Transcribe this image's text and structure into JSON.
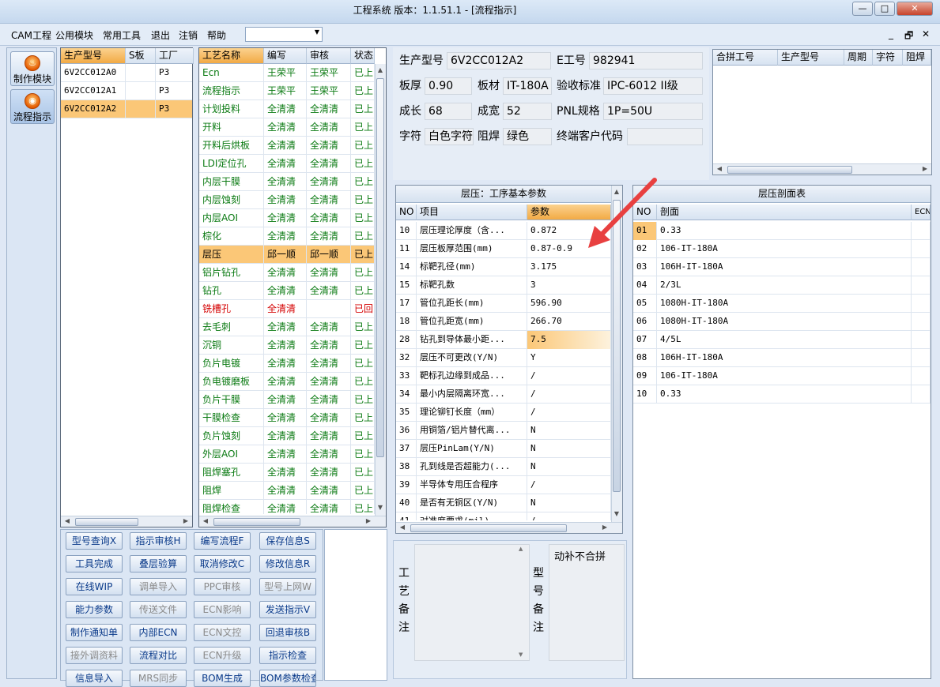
{
  "window": {
    "title": "工程系统  版本：1.1.51.1 - [流程指示]",
    "minimize": "—",
    "maximize": "□",
    "close": "✕"
  },
  "menu": [
    "CAM工程",
    "公用模块",
    "常用工具",
    "退出",
    "注销",
    "帮助"
  ],
  "mdi_controls": [
    "_",
    "🗗",
    "✕"
  ],
  "nav": [
    {
      "label": "制作模块",
      "icon": "fire-icon"
    },
    {
      "label": "流程指示",
      "icon": "gauge-icon"
    }
  ],
  "models_grid": {
    "headers": [
      "生产型号",
      "S板",
      "工厂"
    ],
    "rows": [
      [
        "6V2CC012A0",
        "",
        "P3"
      ],
      [
        "6V2CC012A1",
        "",
        "P3"
      ],
      [
        "6V2CC012A2",
        "",
        "P3"
      ]
    ],
    "selected": 2
  },
  "process_grid": {
    "headers": [
      "工艺名称",
      "编写",
      "审核",
      "状态"
    ],
    "rows": [
      [
        "Ecn",
        "王荣平",
        "王荣平",
        "已上"
      ],
      [
        "流程指示",
        "王荣平",
        "王荣平",
        "已上"
      ],
      [
        "计划投料",
        "全清清",
        "全清清",
        "已上"
      ],
      [
        "开料",
        "全清清",
        "全清清",
        "已上"
      ],
      [
        "开料后烘板",
        "全清清",
        "全清清",
        "已上"
      ],
      [
        "LDI定位孔",
        "全清清",
        "全清清",
        "已上"
      ],
      [
        "内层干膜",
        "全清清",
        "全清清",
        "已上"
      ],
      [
        "内层蚀刻",
        "全清清",
        "全清清",
        "已上"
      ],
      [
        "内层AOI",
        "全清清",
        "全清清",
        "已上"
      ],
      [
        "棕化",
        "全清清",
        "全清清",
        "已上"
      ],
      [
        "层压",
        "邱一顺",
        "邱一顺",
        "已上"
      ],
      [
        "铝片钻孔",
        "全清清",
        "全清清",
        "已上"
      ],
      [
        "钻孔",
        "全清清",
        "全清清",
        "已上"
      ],
      [
        "铣槽孔",
        "全清清",
        "",
        "已回"
      ],
      [
        "去毛刺",
        "全清清",
        "全清清",
        "已上"
      ],
      [
        "沉铜",
        "全清清",
        "全清清",
        "已上"
      ],
      [
        "负片电镀",
        "全清清",
        "全清清",
        "已上"
      ],
      [
        "负电镀磨板",
        "全清清",
        "全清清",
        "已上"
      ],
      [
        "负片干膜",
        "全清清",
        "全清清",
        "已上"
      ],
      [
        "干膜检查",
        "全清清",
        "全清清",
        "已上"
      ],
      [
        "负片蚀刻",
        "全清清",
        "全清清",
        "已上"
      ],
      [
        "外层AOI",
        "全清清",
        "全清清",
        "已上"
      ],
      [
        "阻焊塞孔",
        "全清清",
        "全清清",
        "已上"
      ],
      [
        "阻焊",
        "全清清",
        "全清清",
        "已上"
      ],
      [
        "阻焊检查",
        "全清清",
        "全清清",
        "已上"
      ]
    ],
    "selected": 10,
    "returned": 13
  },
  "info": {
    "prod_model_label": "生产型号",
    "prod_model": "6V2CC012A2",
    "eno_label": "E工号",
    "eno": "982941",
    "thickness_label": "板厚",
    "thickness": "0.90",
    "material_label": "板材",
    "material": "IT-180A",
    "standard_label": "验收标准",
    "standard": "IPC-6012 II级",
    "length_label": "成长",
    "length": "68",
    "width_label": "成宽",
    "width": "52",
    "pnl_label": "PNL规格",
    "pnl": "1P=50U",
    "char_label": "字符",
    "char": "白色字符",
    "mask_label": "阻焊",
    "mask": "绿色",
    "customer_label": "终端客户代码",
    "customer": ""
  },
  "merge_grid": {
    "headers": [
      "合拼工号",
      "生产型号",
      "周期",
      "字符",
      "阻焊"
    ]
  },
  "params": {
    "title": "层压：工序基本参数",
    "headers": [
      "NO",
      "项目",
      "参数"
    ],
    "rows": [
      [
        "10",
        "层压理论厚度（含...",
        "0.872"
      ],
      [
        "11",
        "层压板厚范围(mm)",
        "0.87-0.9"
      ],
      [
        "14",
        "标靶孔径(mm)",
        "3.175"
      ],
      [
        "15",
        "标靶孔数",
        "3"
      ],
      [
        "17",
        "管位孔距长(mm)",
        "596.90"
      ],
      [
        "18",
        "管位孔距宽(mm)",
        "266.70"
      ],
      [
        "28",
        "钻孔到导体最小距...",
        "7.5"
      ],
      [
        "32",
        "层压不可更改(Y/N)",
        "Y"
      ],
      [
        "33",
        "靶标孔边缘到成品...",
        "/"
      ],
      [
        "34",
        "最小内层隔离环宽...",
        "/"
      ],
      [
        "35",
        "理论铆钉长度（mm）",
        "/"
      ],
      [
        "36",
        "用铜箔/铝片替代离...",
        "N"
      ],
      [
        "37",
        "层压PinLam(Y/N)",
        "N"
      ],
      [
        "38",
        "孔到线是否超能力(...",
        "N"
      ],
      [
        "39",
        "半导体专用压合程序",
        "/"
      ],
      [
        "40",
        "是否有无铜区(Y/N)",
        "N"
      ],
      [
        "41",
        "对准度要求(mil)",
        "/"
      ]
    ],
    "selected": 6
  },
  "section": {
    "title": "层压剖面表",
    "headers": [
      "NO",
      "剖面",
      "ECN"
    ],
    "rows": [
      [
        "01",
        "0.33"
      ],
      [
        "02",
        "106-IT-180A"
      ],
      [
        "03",
        "106H-IT-180A"
      ],
      [
        "04",
        "2/3L"
      ],
      [
        "05",
        "1080H-IT-180A"
      ],
      [
        "06",
        "1080H-IT-180A"
      ],
      [
        "07",
        "4/5L"
      ],
      [
        "08",
        "106H-IT-180A"
      ],
      [
        "09",
        "106-IT-180A"
      ],
      [
        "10",
        "0.33"
      ]
    ],
    "selected": 0
  },
  "remarks": {
    "process_label": "工艺备注",
    "model_label": "型号备注",
    "process_text": "",
    "model_text": "动补不合拼"
  },
  "buttons": [
    [
      "型号查询X",
      "指示审核H",
      "编写流程F",
      "保存信息S"
    ],
    [
      "工具完成",
      "叠层验算",
      "取消修改C",
      "修改信息R"
    ],
    [
      "在线WIP",
      "调单导入",
      "PPC审核",
      "型号上网W"
    ],
    [
      "能力参数",
      "传送文件",
      "ECN影响",
      "发送指示V"
    ],
    [
      "制作通知单",
      "内部ECN",
      "ECN文控",
      "回退审核B"
    ],
    [
      "接外调资料",
      "流程对比",
      "ECN升级",
      "指示检查"
    ],
    [
      "信息导入",
      "MRS同步",
      "BOM生成",
      "BOM参数检查"
    ]
  ],
  "buttons_disabled": [
    [
      2,
      1
    ],
    [
      2,
      2
    ],
    [
      2,
      3
    ],
    [
      3,
      1
    ],
    [
      3,
      2
    ],
    [
      4,
      2
    ],
    [
      5,
      0
    ],
    [
      5,
      2
    ],
    [
      6,
      1
    ]
  ],
  "colors": {
    "selected_row": "#fbc777",
    "green_text": "#0a7a12",
    "red_text": "#d40000",
    "arrow": "#e84040"
  }
}
